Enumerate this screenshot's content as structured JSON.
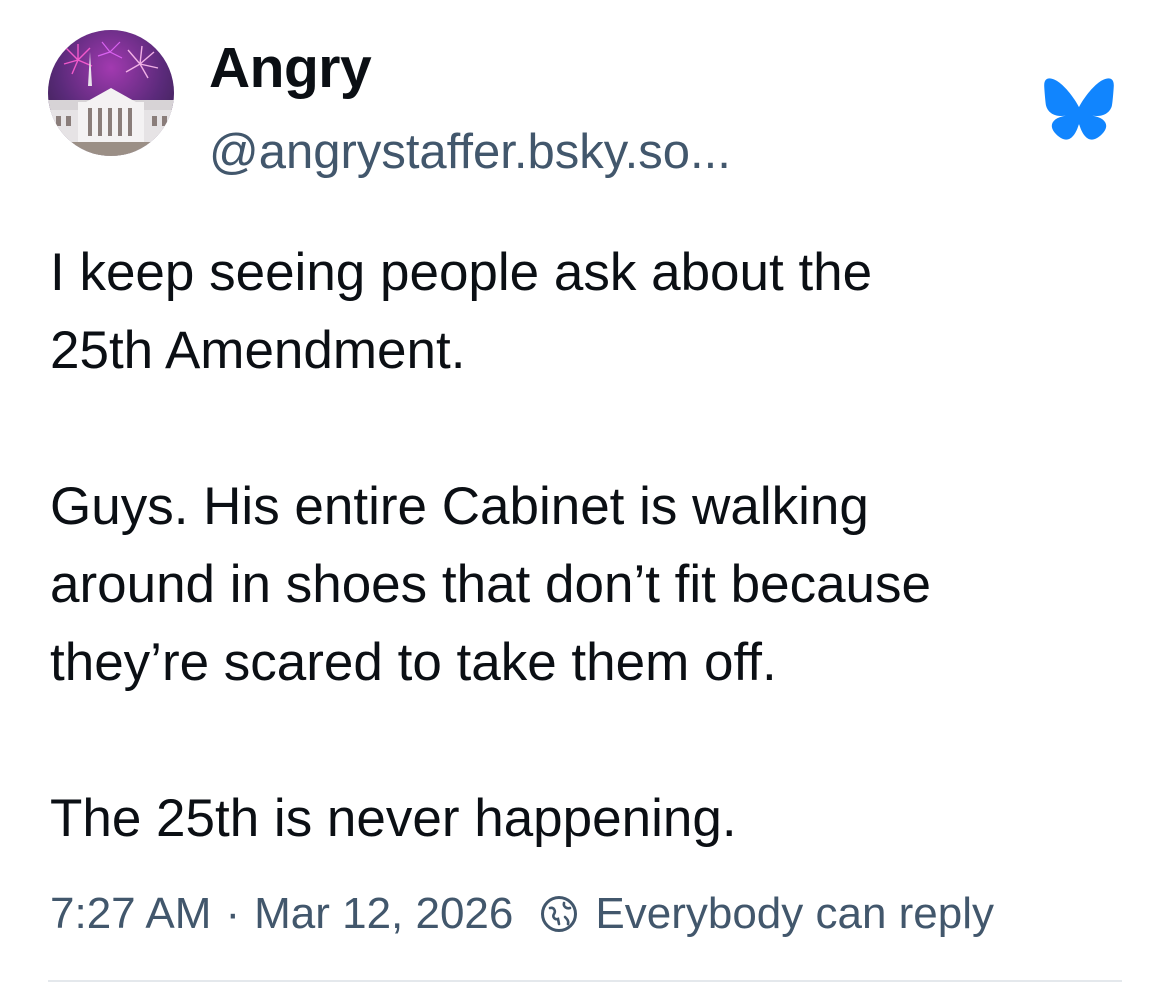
{
  "author": {
    "display_name": "Angry",
    "handle": "@angrystaffer.bsky.so..."
  },
  "post": {
    "paragraphs": [
      "I keep seeing people ask about the\n25th Amendment.",
      "Guys. His entire Cabinet is walking\naround in shoes that don’t fit because\nthey’re scared to take them off.",
      "The 25th is never happening."
    ]
  },
  "meta": {
    "time": "7:27 AM",
    "separator": "·",
    "date": "Mar 12, 2026",
    "reply_setting": "Everybody can reply"
  },
  "icons": {
    "brand": "bluesky-butterfly-icon",
    "reply_setting": "globe-icon",
    "avatar": "white-house-fireworks-avatar"
  },
  "colors": {
    "brand_blue": "#1185fe",
    "text_primary": "#0b0f14",
    "text_secondary": "#42576c",
    "divider": "#e4e8ec"
  }
}
